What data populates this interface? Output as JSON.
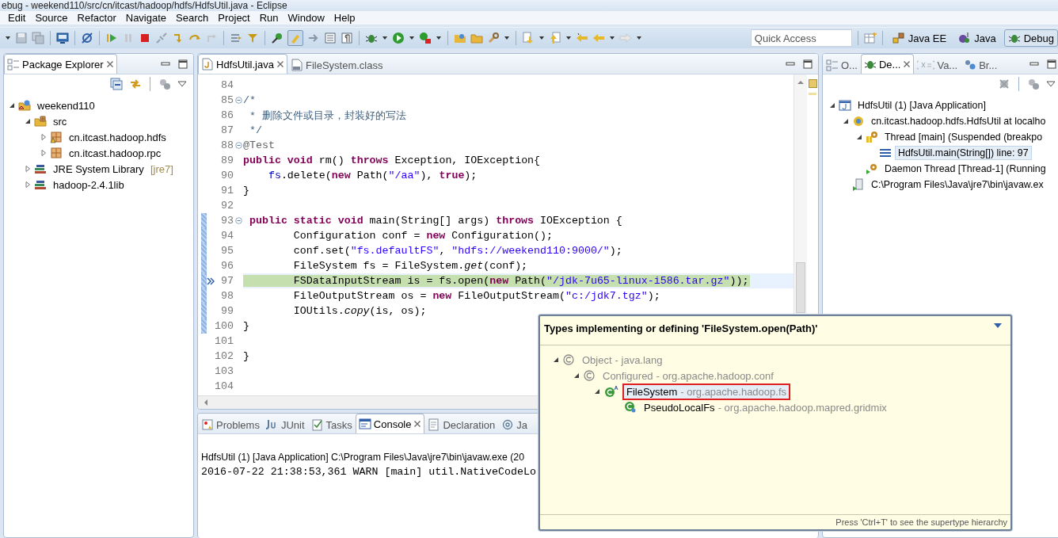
{
  "window": {
    "title": "ebug - weekend110/src/cn/itcast/hadoop/hdfs/HdfsUtil.java - Eclipse"
  },
  "menu": [
    "Edit",
    "Source",
    "Refactor",
    "Navigate",
    "Search",
    "Project",
    "Run",
    "Window",
    "Help"
  ],
  "quick_access": {
    "placeholder": "Quick Access"
  },
  "perspectives": [
    {
      "label": "Java EE",
      "kind": "javaee",
      "selected": false
    },
    {
      "label": "Java",
      "kind": "java",
      "selected": false
    },
    {
      "label": "Debug",
      "kind": "debug",
      "selected": true
    }
  ],
  "package_explorer": {
    "tabs": [
      {
        "label": "Package Explorer",
        "selected": true
      }
    ],
    "tree": [
      {
        "label": "weekend110",
        "kind": "project",
        "expanded": true,
        "children": [
          {
            "label": "src",
            "kind": "source-folder",
            "expanded": true,
            "children": [
              {
                "label": "cn.itcast.hadoop.hdfs",
                "kind": "package-warning",
                "expanded": false
              },
              {
                "label": "cn.itcast.hadoop.rpc",
                "kind": "package",
                "expanded": false
              }
            ]
          },
          {
            "label": "JRE System Library",
            "decoration": "[jre7]",
            "kind": "library",
            "expanded": false
          },
          {
            "label": "hadoop-2.4.1lib",
            "kind": "library",
            "expanded": false
          }
        ]
      }
    ]
  },
  "editor": {
    "tabs": [
      {
        "label": "HdfsUtil.java",
        "kind": "java",
        "selected": true
      },
      {
        "label": "FileSystem.class",
        "kind": "class",
        "selected": false
      }
    ],
    "lines": [
      {
        "number": "84",
        "fold": false,
        "in_range": false,
        "current": false
      },
      {
        "number": "85",
        "fold": true,
        "in_range": false,
        "current": false,
        "tokens": [
          {
            "kind": "comment",
            "text": "/*"
          }
        ]
      },
      {
        "number": "86",
        "fold": false,
        "in_range": false,
        "current": false,
        "tokens": [
          {
            "kind": "comment",
            "text": " * 删除文件或目录，封装好的写法"
          }
        ]
      },
      {
        "number": "87",
        "fold": false,
        "in_range": false,
        "current": false,
        "tokens": [
          {
            "kind": "comment",
            "text": " */"
          }
        ]
      },
      {
        "number": "88",
        "fold": true,
        "in_range": false,
        "current": false,
        "tokens": [
          {
            "kind": "annotation",
            "text": "@Test"
          }
        ]
      },
      {
        "number": "89",
        "fold": false,
        "in_range": false,
        "current": false,
        "tokens": [
          {
            "kind": "keyword",
            "text": "public void"
          },
          {
            "kind": "plain",
            "text": " rm() "
          },
          {
            "kind": "keyword",
            "text": "throws"
          },
          {
            "kind": "plain",
            "text": " Exception, IOException{"
          }
        ]
      },
      {
        "number": "90",
        "fold": false,
        "in_range": false,
        "current": false,
        "tokens": [
          {
            "kind": "field",
            "text": "    fs"
          },
          {
            "kind": "plain",
            "text": ".delete("
          },
          {
            "kind": "keyword",
            "text": "new"
          },
          {
            "kind": "plain",
            "text": " Path("
          },
          {
            "kind": "string",
            "text": "\"/aa\""
          },
          {
            "kind": "plain",
            "text": "), "
          },
          {
            "kind": "keyword",
            "text": "true"
          },
          {
            "kind": "plain",
            "text": ");"
          }
        ]
      },
      {
        "number": "91",
        "fold": false,
        "in_range": false,
        "current": false,
        "tokens": [
          {
            "kind": "plain",
            "text": "}"
          }
        ]
      },
      {
        "number": "92",
        "fold": false,
        "in_range": false,
        "current": false
      },
      {
        "number": "93",
        "fold": true,
        "in_range": true,
        "current": false,
        "tokens": [
          {
            "kind": "keyword",
            "text": " public static void"
          },
          {
            "kind": "plain",
            "text": " main(String[] args) "
          },
          {
            "kind": "keyword",
            "text": "throws"
          },
          {
            "kind": "plain",
            "text": " IOException {"
          }
        ]
      },
      {
        "number": "94",
        "fold": false,
        "in_range": true,
        "current": false,
        "tokens": [
          {
            "kind": "plain",
            "text": "        Configuration conf = "
          },
          {
            "kind": "keyword",
            "text": "new"
          },
          {
            "kind": "plain",
            "text": " Configuration();"
          }
        ]
      },
      {
        "number": "95",
        "fold": false,
        "in_range": true,
        "current": false,
        "tokens": [
          {
            "kind": "plain",
            "text": "        conf.set("
          },
          {
            "kind": "string",
            "text": "\"fs.defaultFS\""
          },
          {
            "kind": "plain",
            "text": ", "
          },
          {
            "kind": "string",
            "text": "\"hdfs://weekend110:9000/\""
          },
          {
            "kind": "plain",
            "text": ");"
          }
        ]
      },
      {
        "number": "96",
        "fold": false,
        "in_range": true,
        "current": false,
        "tokens": [
          {
            "kind": "plain",
            "text": "        FileSystem fs = FileSystem."
          },
          {
            "kind": "static",
            "text": "get"
          },
          {
            "kind": "plain",
            "text": "(conf);"
          }
        ]
      },
      {
        "number": "97",
        "fold": false,
        "in_range": true,
        "current": true,
        "tokens": [
          {
            "kind": "plain",
            "text": "        FSDataInputStream is = fs.open("
          },
          {
            "kind": "keyword",
            "text": "new"
          },
          {
            "kind": "plain",
            "text": " Path("
          },
          {
            "kind": "string",
            "text": "\"/jdk-7u65-linux-i586.tar.gz\""
          },
          {
            "kind": "plain",
            "text": "));"
          }
        ]
      },
      {
        "number": "98",
        "fold": false,
        "in_range": true,
        "current": false,
        "tokens": [
          {
            "kind": "plain",
            "text": "        FileOutputStream os = "
          },
          {
            "kind": "keyword",
            "text": "new"
          },
          {
            "kind": "plain",
            "text": " FileOutputStream("
          },
          {
            "kind": "string",
            "text": "\"c:/jdk7.tgz\""
          },
          {
            "kind": "plain",
            "text": ");"
          }
        ]
      },
      {
        "number": "99",
        "fold": false,
        "in_range": true,
        "current": false,
        "tokens": [
          {
            "kind": "plain",
            "text": "        IOUtils."
          },
          {
            "kind": "static",
            "text": "copy"
          },
          {
            "kind": "plain",
            "text": "(is, os);"
          }
        ]
      },
      {
        "number": "100",
        "fold": false,
        "in_range": true,
        "current": false,
        "tokens": [
          {
            "kind": "plain",
            "text": "}"
          }
        ]
      },
      {
        "number": "101",
        "fold": false,
        "in_range": false,
        "current": false
      },
      {
        "number": "102",
        "fold": false,
        "in_range": false,
        "current": false,
        "tokens": [
          {
            "kind": "plain",
            "text": "}"
          }
        ]
      },
      {
        "number": "103",
        "fold": false,
        "in_range": false,
        "current": false
      },
      {
        "number": "104",
        "fold": false,
        "in_range": false,
        "current": false
      }
    ]
  },
  "console": {
    "tabs": [
      {
        "label": "Problems",
        "kind": "problems",
        "selected": false
      },
      {
        "label": "JUnit",
        "kind": "junit",
        "selected": false
      },
      {
        "label": "Tasks",
        "kind": "tasks",
        "selected": false
      },
      {
        "label": "Console",
        "kind": "console",
        "selected": true
      },
      {
        "label": "Declaration",
        "kind": "declaration",
        "selected": false
      },
      {
        "label": "Ja",
        "kind": "javadoc",
        "selected": false
      }
    ],
    "header": "HdfsUtil (1) [Java Application] C:\\Program Files\\Java\\jre7\\bin\\javaw.exe (20",
    "output": [
      "2016-07-22 21:38:53,361 WARN  [main] util.NativeCodeLo"
    ]
  },
  "debug_view": {
    "tabs": [
      {
        "label": "O...",
        "kind": "outline",
        "selected": false
      },
      {
        "label": "De...",
        "kind": "debug",
        "selected": true
      },
      {
        "label": "Va...",
        "kind": "variables",
        "selected": false
      },
      {
        "label": "Br...",
        "kind": "breakpoints",
        "selected": false
      }
    ],
    "tree": [
      {
        "label": "HdfsUtil (1) [Java Application]",
        "kind": "launch",
        "expanded": true,
        "selected": false,
        "children": [
          {
            "label": "cn.itcast.hadoop.hdfs.HdfsUtil at localho",
            "kind": "vm",
            "expanded": true,
            "selected": false,
            "children": [
              {
                "label": "Thread [main] (Suspended (breakpo",
                "kind": "thread",
                "expanded": true,
                "selected": false,
                "children": [
                  {
                    "label": "HdfsUtil.main(String[]) line: 97",
                    "kind": "frame",
                    "selected": true
                  }
                ]
              },
              {
                "label": "Daemon Thread [Thread-1] (Running",
                "kind": "thread-running",
                "selected": false
              }
            ]
          },
          {
            "label": "C:\\Program Files\\Java\\jre7\\bin\\javaw.ex",
            "kind": "process",
            "selected": false
          }
        ]
      }
    ]
  },
  "hierarchy_popup": {
    "title": "Types implementing or defining 'FileSystem.open(Path)'",
    "tree": [
      {
        "name": "Object",
        "qualifier": "- java.lang",
        "kind": "class",
        "dimmed": true,
        "selected": false,
        "marked": false,
        "expanded": true,
        "children": [
          {
            "name": "Configured",
            "qualifier": "- org.apache.hadoop.conf",
            "kind": "class",
            "dimmed": true,
            "selected": false,
            "marked": false,
            "expanded": true,
            "children": [
              {
                "name": "FileSystem",
                "qualifier": "- org.apache.hadoop.fs",
                "kind": "abstract-class",
                "dimmed": false,
                "selected": true,
                "marked": true,
                "expanded": true,
                "children": [
                  {
                    "name": "PseudoLocalFs",
                    "qualifier": "- org.apache.hadoop.mapred.gridmix",
                    "kind": "subclass",
                    "dimmed": false,
                    "selected": false,
                    "marked": false
                  }
                ]
              }
            ]
          }
        ]
      }
    ],
    "hint": "Press 'Ctrl+T' to see the supertype hierarchy"
  }
}
